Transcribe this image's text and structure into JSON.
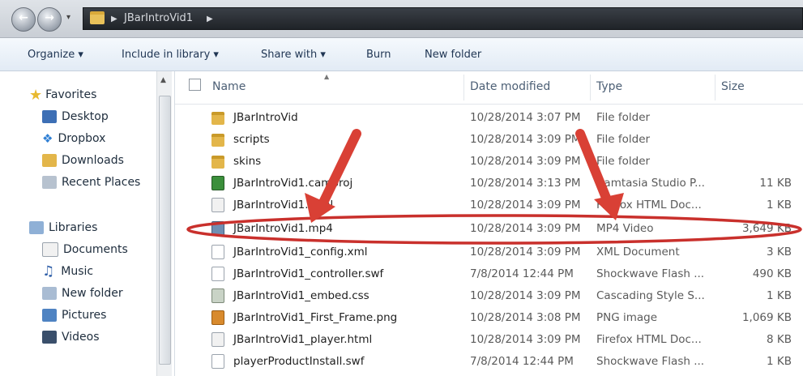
{
  "addressbar": {
    "path": [
      "JBarIntroVid1"
    ]
  },
  "toolbar": {
    "organize": "Organize ▾",
    "include": "Include in library ▾",
    "share": "Share with ▾",
    "burn": "Burn",
    "newfolder": "New folder"
  },
  "sidebar": {
    "favorites": "Favorites",
    "desktop": "Desktop",
    "dropbox": "Dropbox",
    "downloads": "Downloads",
    "recent": "Recent Places",
    "libraries": "Libraries",
    "documents": "Documents",
    "music": "Music",
    "newfolder": "New folder",
    "pictures": "Pictures",
    "videos": "Videos"
  },
  "columns": {
    "name": "Name",
    "date": "Date modified",
    "type": "Type",
    "size": "Size"
  },
  "files": [
    {
      "name": "JBarIntroVid",
      "date": "10/28/2014 3:07 PM",
      "type": "File folder",
      "size": "",
      "icon": "folder-icon"
    },
    {
      "name": "scripts",
      "date": "10/28/2014 3:09 PM",
      "type": "File folder",
      "size": "",
      "icon": "folder-icon"
    },
    {
      "name": "skins",
      "date": "10/28/2014 3:09 PM",
      "type": "File folder",
      "size": "",
      "icon": "folder-icon"
    },
    {
      "name": "JBarIntroVid1.camproj",
      "date": "10/28/2014 3:13 PM",
      "type": "Camtasia Studio P...",
      "size": "11 KB",
      "icon": "camtasia-icon"
    },
    {
      "name": "JBarIntroVid1.html",
      "date": "10/28/2014 3:09 PM",
      "type": "Firefox HTML Doc...",
      "size": "1 KB",
      "icon": "html-file-icon"
    },
    {
      "name": "JBarIntroVid1.mp4",
      "date": "10/28/2014 3:09 PM",
      "type": "MP4 Video",
      "size": "3,649 KB",
      "icon": "video-file-icon"
    },
    {
      "name": "JBarIntroVid1_config.xml",
      "date": "10/28/2014 3:09 PM",
      "type": "XML Document",
      "size": "3 KB",
      "icon": "xml-file-icon"
    },
    {
      "name": "JBarIntroVid1_controller.swf",
      "date": "7/8/2014 12:44 PM",
      "type": "Shockwave Flash ...",
      "size": "490 KB",
      "icon": "swf-file-icon"
    },
    {
      "name": "JBarIntroVid1_embed.css",
      "date": "10/28/2014 3:09 PM",
      "type": "Cascading Style S...",
      "size": "1 KB",
      "icon": "css-file-icon"
    },
    {
      "name": "JBarIntroVid1_First_Frame.png",
      "date": "10/28/2014 3:08 PM",
      "type": "PNG image",
      "size": "1,069 KB",
      "icon": "png-file-icon"
    },
    {
      "name": "JBarIntroVid1_player.html",
      "date": "10/28/2014 3:09 PM",
      "type": "Firefox HTML Doc...",
      "size": "8 KB",
      "icon": "html-file-icon"
    },
    {
      "name": "playerProductInstall.swf",
      "date": "7/8/2014 12:44 PM",
      "type": "Shockwave Flash ...",
      "size": "1 KB",
      "icon": "swf-file-icon"
    }
  ],
  "annotation": {
    "arrow_color": "#d94035",
    "highlight_color": "#c9302c",
    "highlighted_file": "JBarIntroVid1.mp4"
  }
}
